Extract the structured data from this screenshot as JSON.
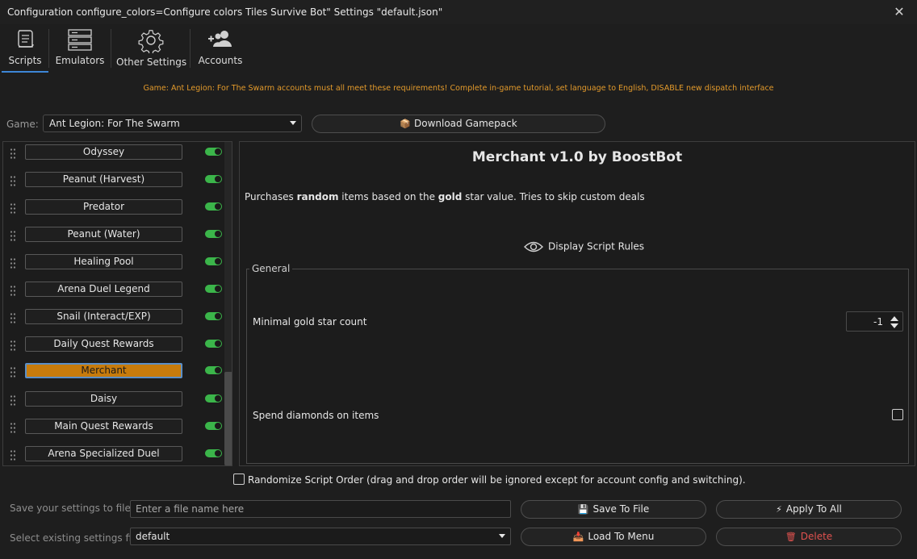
{
  "window": {
    "title": "Configuration configure_colors=Configure colors Tiles Survive Bot\" Settings \"default.json\"",
    "close_glyph": "✕"
  },
  "tabs": [
    {
      "label": "Scripts",
      "icon": "scroll-icon",
      "active": true
    },
    {
      "label": "Emulators",
      "icon": "server-icon",
      "active": false
    },
    {
      "label": "Other Settings",
      "icon": "gear-icon",
      "active": false
    },
    {
      "label": "Accounts",
      "icon": "add-users-icon",
      "active": false
    }
  ],
  "notice": "Game: Ant Legion: For The Swarm accounts must all meet these requirements! Complete in-game tutorial, set language to English, DISABLE new dispatch interface",
  "game": {
    "label": "Game:",
    "selected": "Ant Legion: For The Swarm",
    "download_label": "Download Gamepack",
    "download_icon": "package-icon"
  },
  "scripts": [
    {
      "name": "Odyssey",
      "enabled": true,
      "active": false
    },
    {
      "name": "Peanut (Harvest)",
      "enabled": true,
      "active": false
    },
    {
      "name": "Predator",
      "enabled": true,
      "active": false
    },
    {
      "name": "Peanut (Water)",
      "enabled": true,
      "active": false
    },
    {
      "name": "Healing Pool",
      "enabled": true,
      "active": false
    },
    {
      "name": "Arena Duel Legend",
      "enabled": true,
      "active": false
    },
    {
      "name": "Snail (Interact/EXP)",
      "enabled": true,
      "active": false
    },
    {
      "name": "Daily Quest Rewards",
      "enabled": true,
      "active": false
    },
    {
      "name": "Merchant",
      "enabled": true,
      "active": true
    },
    {
      "name": "Daisy",
      "enabled": true,
      "active": false
    },
    {
      "name": "Main Quest Rewards",
      "enabled": true,
      "active": false
    },
    {
      "name": "Arena Specialized Duel",
      "enabled": true,
      "active": false
    }
  ],
  "detail": {
    "title": "Merchant v1.0 by BoostBot",
    "desc_pre": "Purchases ",
    "desc_bold1": "random",
    "desc_mid": " items based on the ",
    "desc_bold2": "gold",
    "desc_post": " star value. Tries to skip custom deals",
    "rules_label": "Display Script Rules",
    "group_title": "General",
    "min_gold_label": "Minimal gold star count",
    "min_gold_value": "-1",
    "spend_diamonds_label": "Spend diamonds on items",
    "spend_diamonds_checked": false
  },
  "randomize": {
    "label": "Randomize Script Order (drag and drop order will be ignored except for account config and switching).",
    "checked": false
  },
  "settings": {
    "save_label": "Save your settings to file",
    "file_placeholder": "Enter a file name here",
    "select_label": "Select existing settings file",
    "selected_file": "default",
    "save_btn": "Save To File",
    "apply_btn": "Apply To All",
    "load_btn": "Load To Menu",
    "delete_btn": "Delete"
  },
  "colors": {
    "accent": "#3d86d6",
    "active_script": "#c77b0c",
    "toggle_on": "#3bb54a",
    "notice": "#e39a2b",
    "danger": "#e0524f"
  }
}
